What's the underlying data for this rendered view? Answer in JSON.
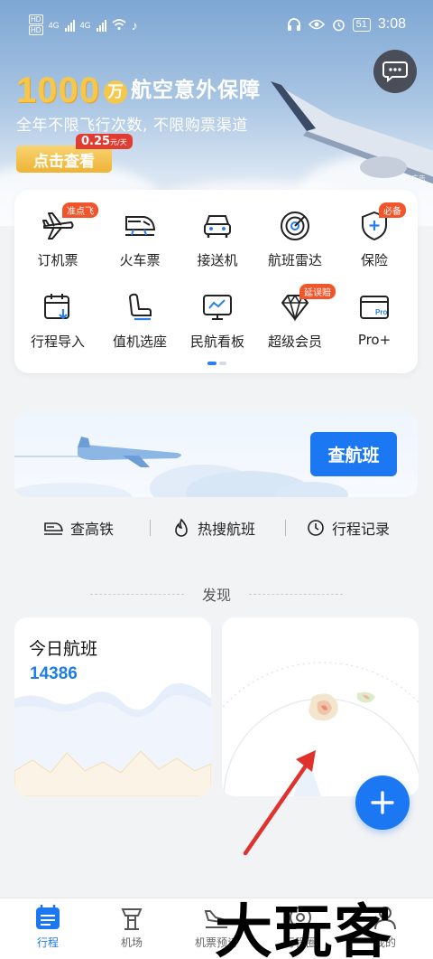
{
  "status_bar": {
    "time": "3:08",
    "battery": "51",
    "network_a": "4G",
    "network_b": "4G"
  },
  "banner": {
    "headline_number": "1000",
    "headline_unit": "万",
    "headline_text": "航空意外保障",
    "subtitle": "全年不限飞行次数, 不限购票渠道",
    "price": "0.25",
    "price_unit": "元/天",
    "cta": "点击查看",
    "ad_tag": "广告",
    "colors": {
      "gold": "#f5c84c",
      "red": "#e13c32"
    }
  },
  "services": [
    {
      "label": "订机票",
      "icon": "airplane-icon",
      "badge": "准点飞"
    },
    {
      "label": "火车票",
      "icon": "train-icon",
      "badge": ""
    },
    {
      "label": "接送机",
      "icon": "car-icon",
      "badge": ""
    },
    {
      "label": "航班雷达",
      "icon": "radar-icon",
      "badge": ""
    },
    {
      "label": "保险",
      "icon": "shield-icon",
      "badge": "必备"
    },
    {
      "label": "行程导入",
      "icon": "calendar-import-icon",
      "badge": ""
    },
    {
      "label": "值机选座",
      "icon": "seat-icon",
      "badge": ""
    },
    {
      "label": "民航看板",
      "icon": "dashboard-icon",
      "badge": ""
    },
    {
      "label": "超级会员",
      "icon": "diamond-icon",
      "badge": "延误赔"
    },
    {
      "label": "Pro+",
      "icon": "pro-card-icon",
      "badge": ""
    }
  ],
  "flight_search": {
    "button": "查航班"
  },
  "quick_links": [
    {
      "label": "查高铁",
      "icon": "train-front-icon"
    },
    {
      "label": "热搜航班",
      "icon": "fire-icon"
    },
    {
      "label": "行程记录",
      "icon": "clock-icon"
    }
  ],
  "discover": {
    "title": "发现",
    "today": {
      "title": "今日航班",
      "count": "14386"
    }
  },
  "tabs": [
    {
      "label": "行程",
      "icon": "itinerary-icon",
      "active": true
    },
    {
      "label": "机场",
      "icon": "airport-tower-icon",
      "active": false
    },
    {
      "label": "机票预订",
      "icon": "plane-landing-icon",
      "active": false
    },
    {
      "label": "行程圈",
      "icon": "circle-icon",
      "active": false
    },
    {
      "label": "我的",
      "icon": "user-icon",
      "active": false
    }
  ],
  "watermark": "大玩客",
  "accent_color": "#1c77f2"
}
